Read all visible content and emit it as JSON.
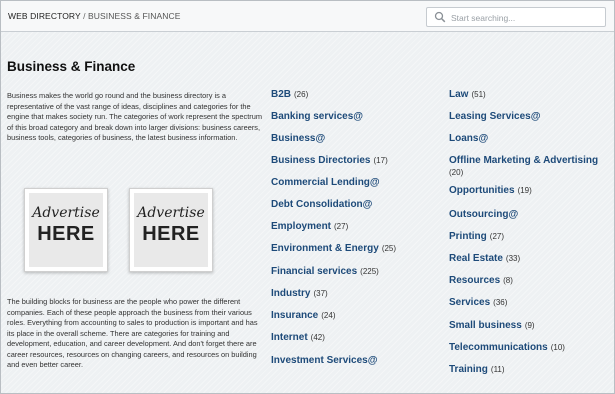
{
  "header": {
    "breadcrumb_root": "WEB DIRECTORY",
    "breadcrumb_separator": "/",
    "breadcrumb_current": "BUSINESS & FINANCE"
  },
  "search": {
    "placeholder": "Start searching..."
  },
  "main": {
    "title": "Business & Finance",
    "intro": "Business makes the world go round and the business directory is a representative of the vast range of ideas, disciplines and categories for the engine that makes society run. The categories of work represent the spectrum of this broad category and break down into larger divisions: business careers, business tools, categories of business, the latest business information.",
    "outro": "The building blocks for business are the people who power the different companies. Each of these people approach the business from their various roles. Everything from accounting to sales to production is important and has its place in the overall scheme. There are categories for training and development, education, and career development. And don't forget there are career resources, resources on changing careers, and resources on building and even better career."
  },
  "ads": [
    {
      "line1": "Advertise",
      "line2": "HERE"
    },
    {
      "line1": "Advertise",
      "line2": "HERE"
    }
  ],
  "categories_left": [
    {
      "name": "B2B",
      "count": "(26)"
    },
    {
      "name": "Banking services@",
      "count": ""
    },
    {
      "name": "Business@",
      "count": ""
    },
    {
      "name": "Business Directories",
      "count": "(17)"
    },
    {
      "name": "Commercial Lending@",
      "count": ""
    },
    {
      "name": "Debt Consolidation@",
      "count": ""
    },
    {
      "name": "Employment",
      "count": "(27)"
    },
    {
      "name": "Environment & Energy",
      "count": "(25)"
    },
    {
      "name": "Financial services",
      "count": "(225)"
    },
    {
      "name": "Industry",
      "count": "(37)"
    },
    {
      "name": "Insurance",
      "count": "(24)"
    },
    {
      "name": "Internet",
      "count": "(42)"
    },
    {
      "name": "Investment Services@",
      "count": ""
    }
  ],
  "categories_right": [
    {
      "name": "Law",
      "count": "(51)"
    },
    {
      "name": "Leasing Services@",
      "count": ""
    },
    {
      "name": "Loans@",
      "count": ""
    },
    {
      "name": "Offline Marketing & Advertising",
      "count": "(20)"
    },
    {
      "name": "Opportunities",
      "count": "(19)"
    },
    {
      "name": "Outsourcing@",
      "count": ""
    },
    {
      "name": "Printing",
      "count": "(27)"
    },
    {
      "name": "Real Estate",
      "count": "(33)"
    },
    {
      "name": "Resources",
      "count": "(8)"
    },
    {
      "name": "Services",
      "count": "(36)"
    },
    {
      "name": "Small business",
      "count": "(9)"
    },
    {
      "name": "Telecommunications",
      "count": "(10)"
    },
    {
      "name": "Training",
      "count": "(11)"
    }
  ],
  "colors": {
    "link": "#1d4a79",
    "background": "#eef1f3"
  },
  "icons": {
    "search": "search-icon"
  }
}
